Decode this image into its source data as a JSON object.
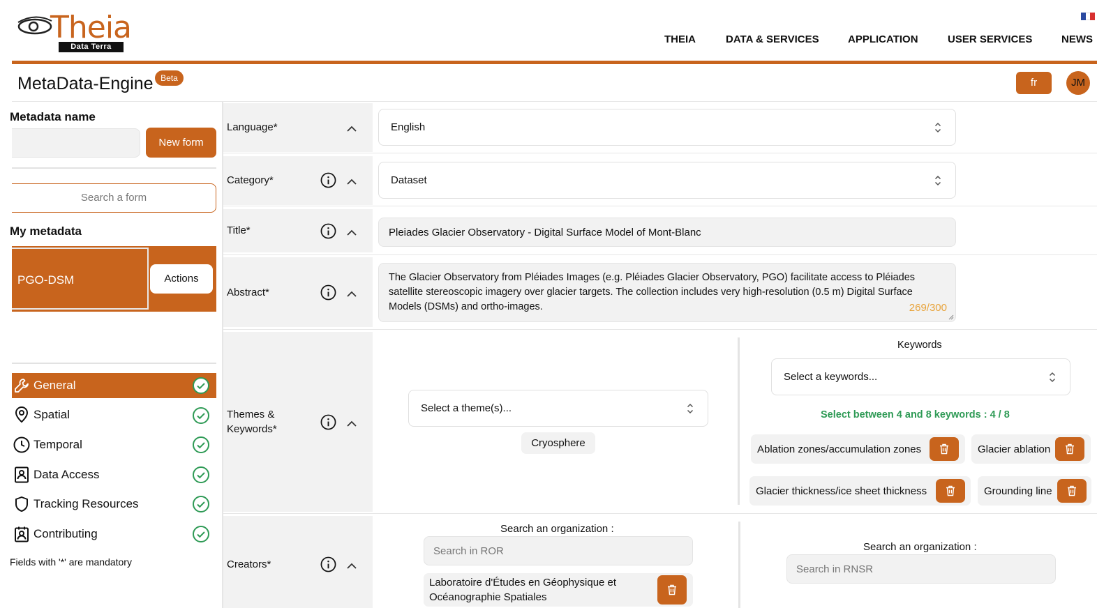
{
  "header": {
    "logo_text": "Theia",
    "logo_tag": "Data Terra",
    "nav": [
      "THEIA",
      "DATA & SERVICES",
      "APPLICATION",
      "USER SERVICES",
      "NEWS"
    ],
    "app_title": "MetaData-Engine",
    "beta": "Beta",
    "lang_button": "fr",
    "avatar": "JM",
    "brand_color": "#c8641d"
  },
  "sidebar": {
    "metadata_name_label": "Metadata name",
    "metadata_name_value": "",
    "new_form_button": "New form",
    "search_form_placeholder": "Search a form",
    "my_metadata_label": "My metadata",
    "card_title": "PGO-DSM",
    "actions_button": "Actions",
    "items": [
      {
        "label": "General",
        "icon": "wrench-icon",
        "done": true,
        "active": true
      },
      {
        "label": "Spatial",
        "icon": "map-pin-icon",
        "done": true
      },
      {
        "label": "Temporal",
        "icon": "clock-icon",
        "done": true
      },
      {
        "label": "Data Access",
        "icon": "contact-book-icon",
        "done": true
      },
      {
        "label": "Tracking Resources",
        "icon": "shield-icon",
        "done": true
      },
      {
        "label": "Contributing",
        "icon": "user-badge-icon",
        "done": true
      }
    ],
    "mandatory_note": "Fields with '*' are mandatory"
  },
  "form": {
    "language": {
      "label": "Language*",
      "value": "English"
    },
    "category": {
      "label": "Category*",
      "value": "Dataset"
    },
    "title": {
      "label": "Title*",
      "value": "Pleiades Glacier Observatory - Digital Surface Model of Mont-Blanc"
    },
    "abstract": {
      "label": "Abstract*",
      "value": "The Glacier Observatory from Pléiades Images (e.g. Pléiades Glacier Observatory, PGO) facilitate access to Pléiades satellite stereoscopic imagery over glacier targets. The collection includes very high-resolution (0.5 m) Digital Surface Models (DSMs) and ortho-images.",
      "counter": "269/300"
    },
    "themes": {
      "label": "Themes & Keywords*",
      "theme_placeholder": "Select a theme(s)...",
      "selected_theme": "Cryosphere",
      "keywords_title": "Keywords",
      "keywords_placeholder": "Select a keywords...",
      "keywords_hint": "Select between 4 and 8 keywords : 4 / 8",
      "keywords": [
        "Ablation zones/accumulation zones",
        "Glacier ablation",
        "Glacier thickness/ice sheet thickness",
        "Grounding line"
      ]
    },
    "creators": {
      "label": "Creators*",
      "ror_title": "Search an organization :",
      "ror_placeholder": "Search in ROR",
      "ror_selected": "Laboratoire d'Études en Géophysique et Océanographie Spatiales",
      "rnsr_title": "Search an organization :",
      "rnsr_placeholder": "Search in RNSR"
    }
  }
}
